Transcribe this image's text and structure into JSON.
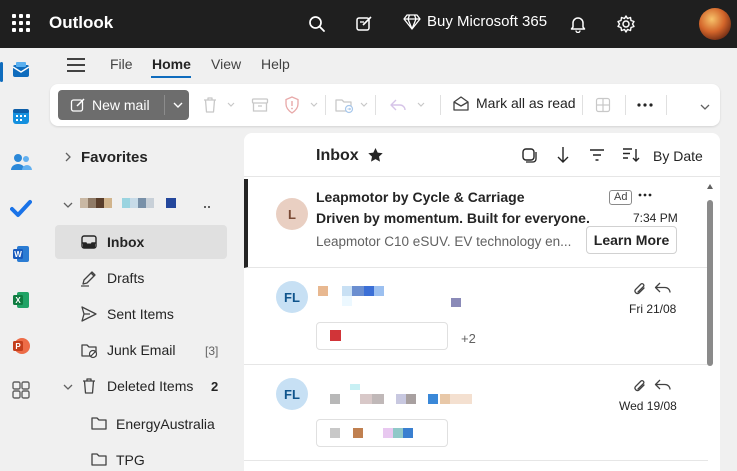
{
  "app": {
    "title": "Outlook"
  },
  "topbar": {
    "buy_label": "Buy Microsoft 365"
  },
  "menu": {
    "tabs": [
      "File",
      "Home",
      "View",
      "Help"
    ],
    "active": "Home"
  },
  "ribbon": {
    "new_mail_label": "New mail",
    "mark_all_read_label": "Mark all as read"
  },
  "folders": {
    "favorites_label": "Favorites",
    "items": [
      {
        "label": "Inbox",
        "count": ""
      },
      {
        "label": "Drafts",
        "count": ""
      },
      {
        "label": "Sent Items",
        "count": ""
      },
      {
        "label": "Junk Email",
        "count": "[3]"
      },
      {
        "label": "Deleted Items",
        "count": "2"
      },
      {
        "label": "EnergyAustralia",
        "count": ""
      },
      {
        "label": "TPG",
        "count": ""
      }
    ]
  },
  "list": {
    "title": "Inbox",
    "sort_label": "By Date",
    "messages": [
      {
        "sender": "Leapmotor by Cycle & Carriage",
        "subject": "Driven by momentum. Built for everyone.",
        "preview": "Leapmotor C10 eSUV. EV technology en...",
        "initials": "L",
        "badge": "Ad",
        "time": "7:34 PM",
        "action_label": "Learn More"
      },
      {
        "initials": "FL",
        "time": "Fri 21/08",
        "extra": "+2"
      },
      {
        "initials": "FL",
        "time": "Wed 19/08"
      }
    ]
  },
  "colors": {
    "accent": "#0f6cbd",
    "topbar": "#1f1f1f",
    "new_mail_button": "#6d6d6d"
  }
}
